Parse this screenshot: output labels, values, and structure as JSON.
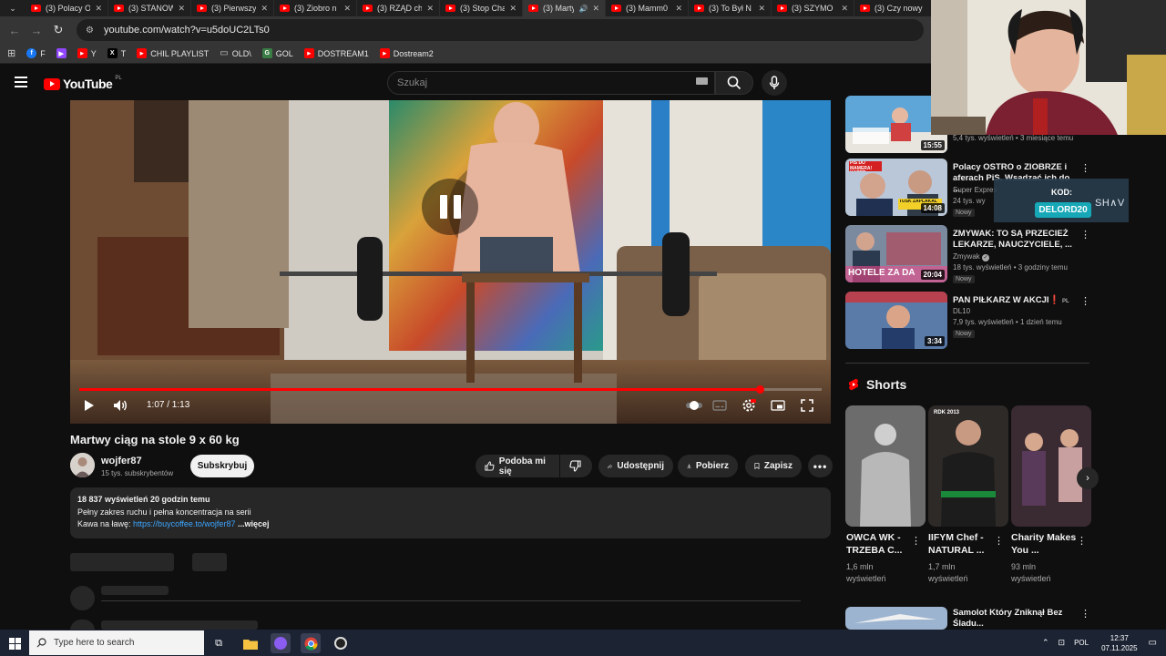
{
  "browser": {
    "tabs": [
      {
        "label": "(3) Polacy O"
      },
      {
        "label": "(3) STANOW"
      },
      {
        "label": "(3) Pierwszy"
      },
      {
        "label": "(3) Ziobro n"
      },
      {
        "label": "(3) RZĄD ch"
      },
      {
        "label": "(3) Stop Cha"
      },
      {
        "label": "(3) Marty"
      },
      {
        "label": "(3) Mamm0"
      },
      {
        "label": "(3) To Był N"
      },
      {
        "label": "(3) SZYMO"
      },
      {
        "label": "(3) Czy nowy"
      }
    ],
    "url": "youtube.com/watch?v=u5doUC2LTs0",
    "bookmarks": [
      "F",
      "",
      "Y",
      "T",
      "CHIL PLAYLIST",
      "OLD\\",
      "GOL",
      "DOSTREAM1",
      "Dostream2"
    ],
    "bookmark_icons": [
      {
        "glyph": "f",
        "color": "#1877f2"
      },
      {
        "glyph": "▶",
        "color": "#9147ff"
      },
      {
        "glyph": "▶",
        "color": "#ff0000"
      },
      {
        "glyph": "X",
        "color": "#000000"
      },
      {
        "glyph": "▶",
        "color": "#ff0000"
      },
      {
        "glyph": "",
        "color": ""
      },
      {
        "glyph": "G",
        "color": "#3a7d44"
      },
      {
        "glyph": "▶",
        "color": "#ff0000"
      },
      {
        "glyph": "▶",
        "color": "#ff0000"
      }
    ]
  },
  "youtube": {
    "logo_text": "YouTube",
    "logo_region": "PL",
    "search_placeholder": "Szukaj"
  },
  "player": {
    "time": "1:07 / 1:13",
    "progress": 0.916
  },
  "video": {
    "title": "Martwy ciąg na stole 9 x 60 kg",
    "channel": "wojfer87",
    "subscribers": "15 tys. subskrybentów",
    "subscribe_label": "Subskrybuj",
    "like_label": "Podoba mi się",
    "share_label": "Udostępnij",
    "download_label": "Pobierz",
    "save_label": "Zapisz",
    "desc_line1": "18 837 wyświetleń  20 godzin temu",
    "desc_line2": "Pełny zakres ruchu i pełna koncentracja na serii",
    "desc_line3_prefix": "Kawa na ławę: ",
    "desc_link": "https://buycoffee.to/wojfer87",
    "desc_more": " ...więcej"
  },
  "recommendations": [
    {
      "title": "",
      "channel": "",
      "meta": "5,4 tys. wyświetleń • 3 miesiące temu",
      "duration": "15:55",
      "badge": ""
    },
    {
      "title": "Polacy OSTRO o ZIOBRZE i aferach PiS. Wsadzać ich do ...",
      "channel": "Super Expres",
      "meta": "24 tys. wy",
      "duration": "14:08",
      "badge": "Nowy"
    },
    {
      "title": "ZMYWAK: TO SĄ PRZECIEŻ LEKARZE, NAUCZYCIELE, ...",
      "channel": "Zmywak",
      "meta": "18 tys. wyświetleń • 3 godziny temu",
      "duration": "20:04",
      "badge": "Nowy"
    },
    {
      "title": "PAN PIŁKARZ W AKCJI❗",
      "channel": "DL10",
      "meta": "7,9 tys. wyświetleń • 1 dzień temu",
      "duration": "3:34",
      "badge": "Nowy"
    },
    {
      "title": "Samolot Który Zniknął Bez Śladu...",
      "channel": "",
      "meta": "",
      "duration": "",
      "badge": ""
    }
  ],
  "rec_title_suffix_pl": "PL",
  "shorts": {
    "heading": "Shorts",
    "items": [
      {
        "title": "OWCA WK - TRZEBA C...",
        "views": "1,6 mln wyświetleń"
      },
      {
        "title": "IIFYM Chef - NATURAL ...",
        "views": "1,7 mln wyświetleń"
      },
      {
        "title": "Charity Makes You ...",
        "views": "93 mln wyświetleń"
      }
    ]
  },
  "overlay": {
    "code_label": "KOD:",
    "code_value": "DELORD20",
    "brand": "SH∧V"
  },
  "thumb_text": {
    "rec1_caption": "PIS DO MAMERA! KAPER",
    "rec1_caption2": "TUSK ZAPLAKAL",
    "rec2_caption": "HOTELE ZA DA",
    "short2_badge": "RDK 2013"
  },
  "taskbar": {
    "search_placeholder": "Type here to search",
    "lang": "POL",
    "time": "12:37",
    "date": "07.11.2025"
  },
  "colors": {
    "accent": "#ff0000",
    "link": "#3ea6ff",
    "background": "#0f0f0f"
  }
}
